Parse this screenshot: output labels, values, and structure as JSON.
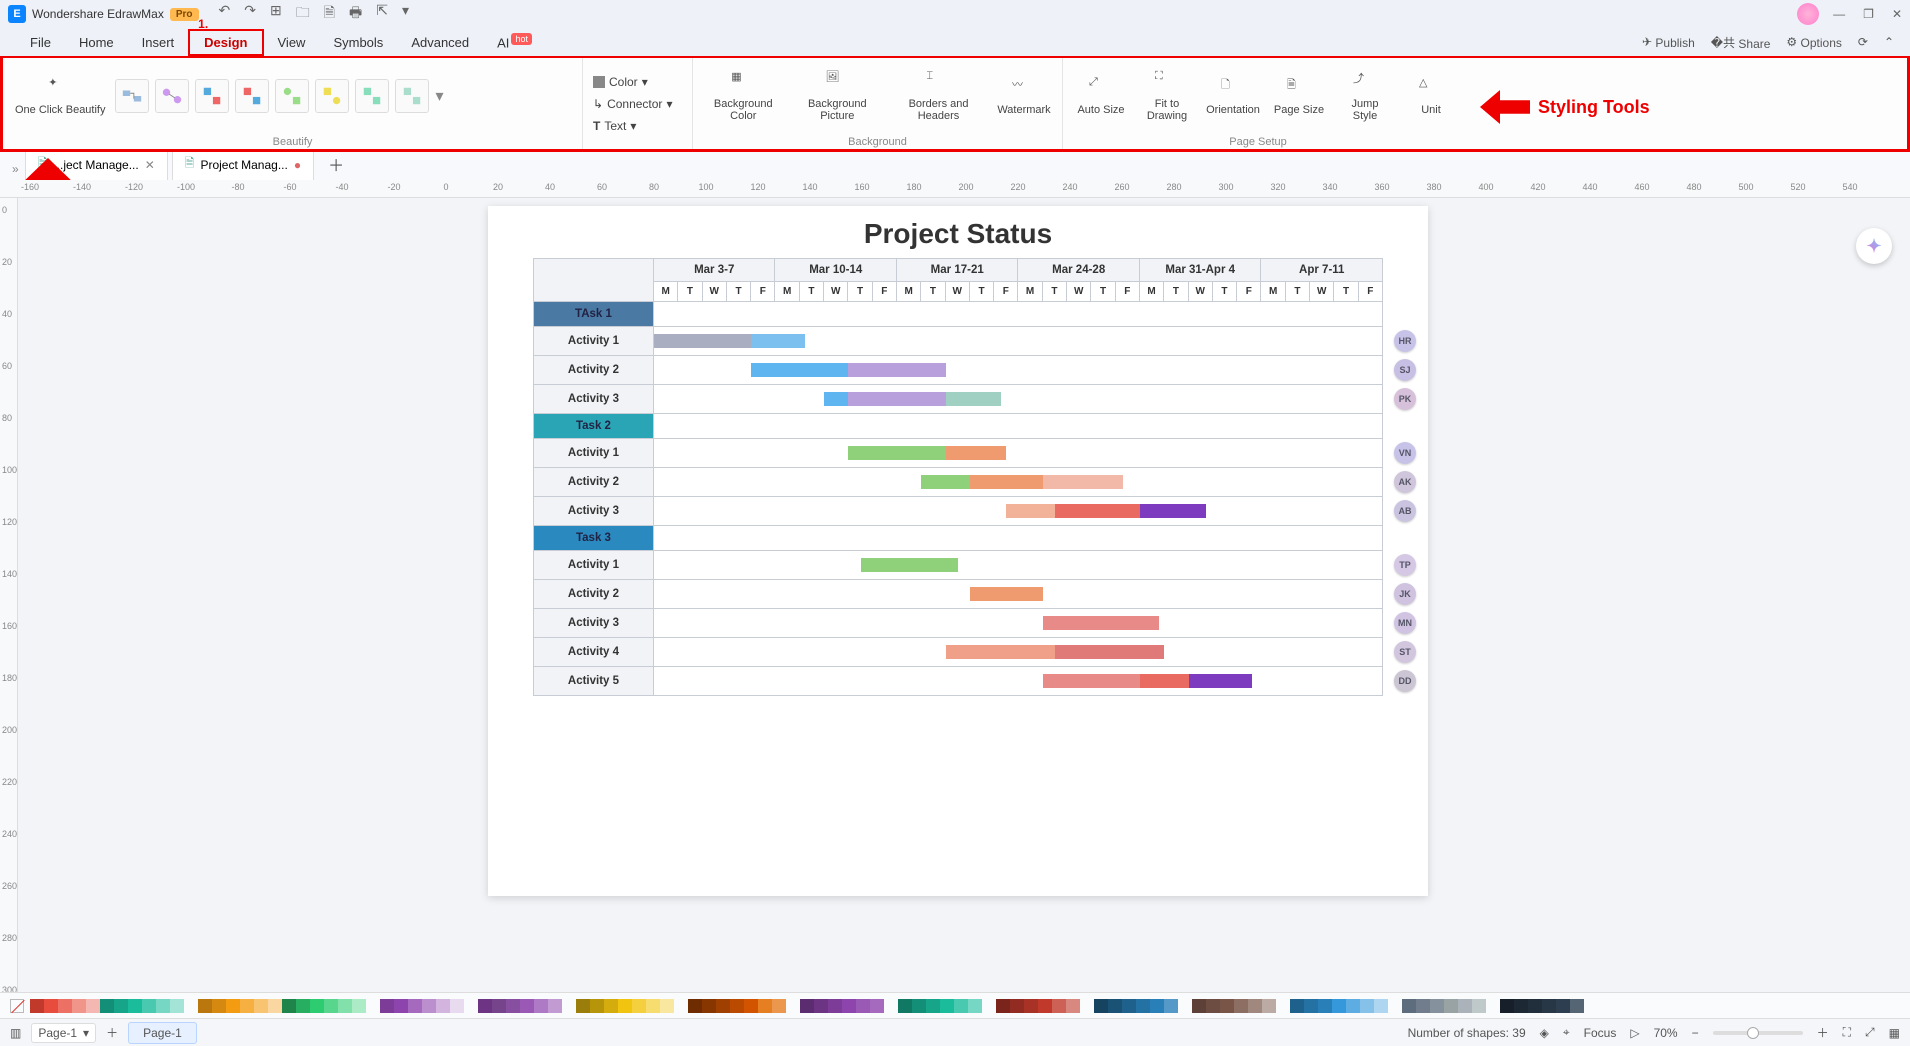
{
  "titlebar": {
    "app_name": "Wondershare EdrawMax",
    "pro": "Pro"
  },
  "menubar": {
    "items": [
      "File",
      "Home",
      "Insert",
      "Design",
      "View",
      "Symbols",
      "Advanced"
    ],
    "active": 3,
    "step_no": "1.",
    "ai": "AI",
    "ai_hot": "hot",
    "right": {
      "publish": "Publish",
      "share": "Share",
      "options": "Options"
    }
  },
  "ribbon": {
    "beautify": {
      "oneclick": "One Click\nBeautify",
      "group_label": "Beautify"
    },
    "style": {
      "color": "Color",
      "connector": "Connector",
      "text": "Text"
    },
    "background": {
      "bg_color": "Background\nColor",
      "bg_picture": "Background\nPicture",
      "borders": "Borders and\nHeaders",
      "watermark": "Watermark",
      "group_label": "Background"
    },
    "pagesetup": {
      "autosize": "Auto\nSize",
      "fit": "Fit to\nDrawing",
      "orientation": "Orientation",
      "pagesize": "Page\nSize",
      "jump": "Jump\nStyle",
      "unit": "Unit",
      "group_label": "Page Setup"
    }
  },
  "annotations": {
    "styling_tools": "Styling Tools",
    "one_click": "One Click Beautify"
  },
  "doctabs": {
    "tabs": [
      {
        "label": "...ject Manage..."
      },
      {
        "label": "Project Manag..."
      }
    ]
  },
  "ruler_h": [
    "-160",
    "-140",
    "-120",
    "-100",
    "-80",
    "-60",
    "-40",
    "-20",
    "0",
    "20",
    "40",
    "60",
    "80",
    "100",
    "120",
    "140",
    "160",
    "180",
    "200",
    "220",
    "240",
    "260",
    "280",
    "300",
    "320",
    "340",
    "360",
    "380",
    "400",
    "420",
    "440",
    "460",
    "480",
    "500",
    "520",
    "540"
  ],
  "ruler_v": [
    "0",
    "20",
    "40",
    "60",
    "80",
    "100",
    "120",
    "140",
    "160",
    "180",
    "200",
    "220",
    "240",
    "260",
    "280",
    "300"
  ],
  "chart_data": {
    "type": "table",
    "title": "Project Status",
    "weeks": [
      "Mar 3-7",
      "Mar 10-14",
      "Mar 17-21",
      "Mar 24-28",
      "Mar 31-Apr 4",
      "Apr 7-11"
    ],
    "days": [
      "M",
      "T",
      "W",
      "T",
      "F"
    ],
    "day_hdr_classes": [
      "dh0",
      "dh1",
      "dh2",
      "dh3",
      "dh4",
      "dh5"
    ],
    "groups": [
      {
        "name": "TAsk 1",
        "cls": "t1",
        "rows": [
          {
            "name": "Activity 1",
            "badge": "HR",
            "badge_c": "#c7c3e8",
            "bars": [
              {
                "s": 0,
                "e": 4,
                "c": "#a9afc0"
              },
              {
                "s": 4,
                "e": 6.2,
                "c": "#7cc0f0"
              }
            ]
          },
          {
            "name": "Activity 2",
            "badge": "SJ",
            "badge_c": "#c8c0e4",
            "bars": [
              {
                "s": 4,
                "e": 8,
                "c": "#5fb5ef"
              },
              {
                "s": 8,
                "e": 12,
                "c": "#b8a0dc"
              }
            ]
          },
          {
            "name": "Activity 3",
            "badge": "PK",
            "badge_c": "#d7c0da",
            "bars": [
              {
                "s": 7,
                "e": 8,
                "c": "#5fb5ef"
              },
              {
                "s": 8,
                "e": 12,
                "c": "#b8a0dc"
              },
              {
                "s": 12,
                "e": 14.3,
                "c": "#9fd0c2"
              }
            ]
          }
        ]
      },
      {
        "name": "Task 2",
        "cls": "t2",
        "rows": [
          {
            "name": "Activity 1",
            "badge": "VN",
            "badge_c": "#c7c3e8",
            "bars": [
              {
                "s": 8,
                "e": 12,
                "c": "#8fd07a"
              },
              {
                "s": 12,
                "e": 14.5,
                "c": "#f09a70"
              }
            ]
          },
          {
            "name": "Activity 2",
            "badge": "AK",
            "badge_c": "#d0c6dc",
            "bars": [
              {
                "s": 11,
                "e": 13,
                "c": "#8fd07a"
              },
              {
                "s": 13,
                "e": 16,
                "c": "#f09a70"
              },
              {
                "s": 16,
                "e": 19.3,
                "c": "#f2b8a8"
              }
            ]
          },
          {
            "name": "Activity 3",
            "badge": "AB",
            "badge_c": "#cac4e0",
            "bars": [
              {
                "s": 14.5,
                "e": 16.5,
                "c": "#f2b29a"
              },
              {
                "s": 16.5,
                "e": 20,
                "c": "#e86a60"
              },
              {
                "s": 20,
                "e": 22.7,
                "c": "#7d3bbf"
              }
            ]
          }
        ]
      },
      {
        "name": "Task 3",
        "cls": "t3",
        "rows": [
          {
            "name": "Activity 1",
            "badge": "TP",
            "badge_c": "#d4c8e4",
            "bars": [
              {
                "s": 8.5,
                "e": 12.5,
                "c": "#8fd07a"
              }
            ]
          },
          {
            "name": "Activity 2",
            "badge": "JK",
            "badge_c": "#cfc3e0",
            "bars": [
              {
                "s": 13,
                "e": 16,
                "c": "#f09a70"
              }
            ]
          },
          {
            "name": "Activity 3",
            "badge": "MN",
            "badge_c": "#d0c4e2",
            "bars": [
              {
                "s": 16,
                "e": 20.8,
                "c": "#e88a88"
              }
            ]
          },
          {
            "name": "Activity 4",
            "badge": "ST",
            "badge_c": "#d2c6de",
            "bars": [
              {
                "s": 12,
                "e": 16.5,
                "c": "#f0a088"
              },
              {
                "s": 16.5,
                "e": 21,
                "c": "#e07a78"
              }
            ]
          },
          {
            "name": "Activity 5",
            "badge": "DD",
            "badge_c": "#ccc6d4",
            "bars": [
              {
                "s": 16,
                "e": 20,
                "c": "#e88a88"
              },
              {
                "s": 20,
                "e": 22,
                "c": "#e86a60"
              },
              {
                "s": 22,
                "e": 24.6,
                "c": "#7d3bbf"
              }
            ]
          }
        ]
      }
    ]
  },
  "palettes": [
    [
      "#c0392b",
      "#e74c3c",
      "#ec7063",
      "#f1948a",
      "#f5b7b1",
      "#148f77",
      "#17a589",
      "#1abc9c",
      "#48c9b0",
      "#76d7c4",
      "#a3e4d7"
    ],
    [
      "#b9770e",
      "#d68910",
      "#f39c12",
      "#f5b041",
      "#f8c471",
      "#fad7a0",
      "#1e8449",
      "#27ae60",
      "#2ecc71",
      "#58d68d",
      "#82e0aa",
      "#abebc6"
    ],
    [
      "#7d3c98",
      "#8e44ad",
      "#a569bd",
      "#bb8fce",
      "#d2b4de",
      "#e8daef"
    ],
    [
      "#6c3483",
      "#76448a",
      "#884ea0",
      "#9b59b6",
      "#af7ac5",
      "#c39bd3"
    ],
    [
      "#9a7d0a",
      "#b7950b",
      "#d4ac0d",
      "#f1c40f",
      "#f4d03f",
      "#f7dc6f",
      "#f9e79f"
    ],
    [
      "#6e2c00",
      "#873600",
      "#a04000",
      "#ba4a00",
      "#d35400",
      "#e67e22",
      "#eb984e"
    ],
    [
      "#5b2c6f",
      "#6c3483",
      "#7d3c98",
      "#8e44ad",
      "#9b59b6",
      "#a569bd"
    ],
    [
      "#117864",
      "#148f77",
      "#17a589",
      "#1abc9c",
      "#48c9b0",
      "#76d7c4"
    ],
    [
      "#7b241c",
      "#922b21",
      "#a93226",
      "#c0392b",
      "#cd6155",
      "#d98880"
    ],
    [
      "#154360",
      "#1a5276",
      "#1f618d",
      "#2471a3",
      "#2980b9",
      "#5499c7"
    ],
    [
      "#5d4037",
      "#6d4c41",
      "#795548",
      "#8d6e63",
      "#a1887f",
      "#bcaaa4"
    ],
    [
      "#1f618d",
      "#2471a3",
      "#2980b9",
      "#3498db",
      "#5dade2",
      "#85c1e9",
      "#aed6f1"
    ],
    [
      "#5d6d7e",
      "#717d8c",
      "#85929e",
      "#99a3a4",
      "#abb2b9",
      "#bfc9ca"
    ],
    [
      "#17202a",
      "#1c2833",
      "#212f3c",
      "#273746",
      "#2c3e50",
      "#566573"
    ]
  ],
  "statusbar": {
    "page_sel": "Page-1",
    "page_tab": "Page-1",
    "shapes": "Number of shapes: 39",
    "focus": "Focus",
    "zoom": "70%"
  }
}
